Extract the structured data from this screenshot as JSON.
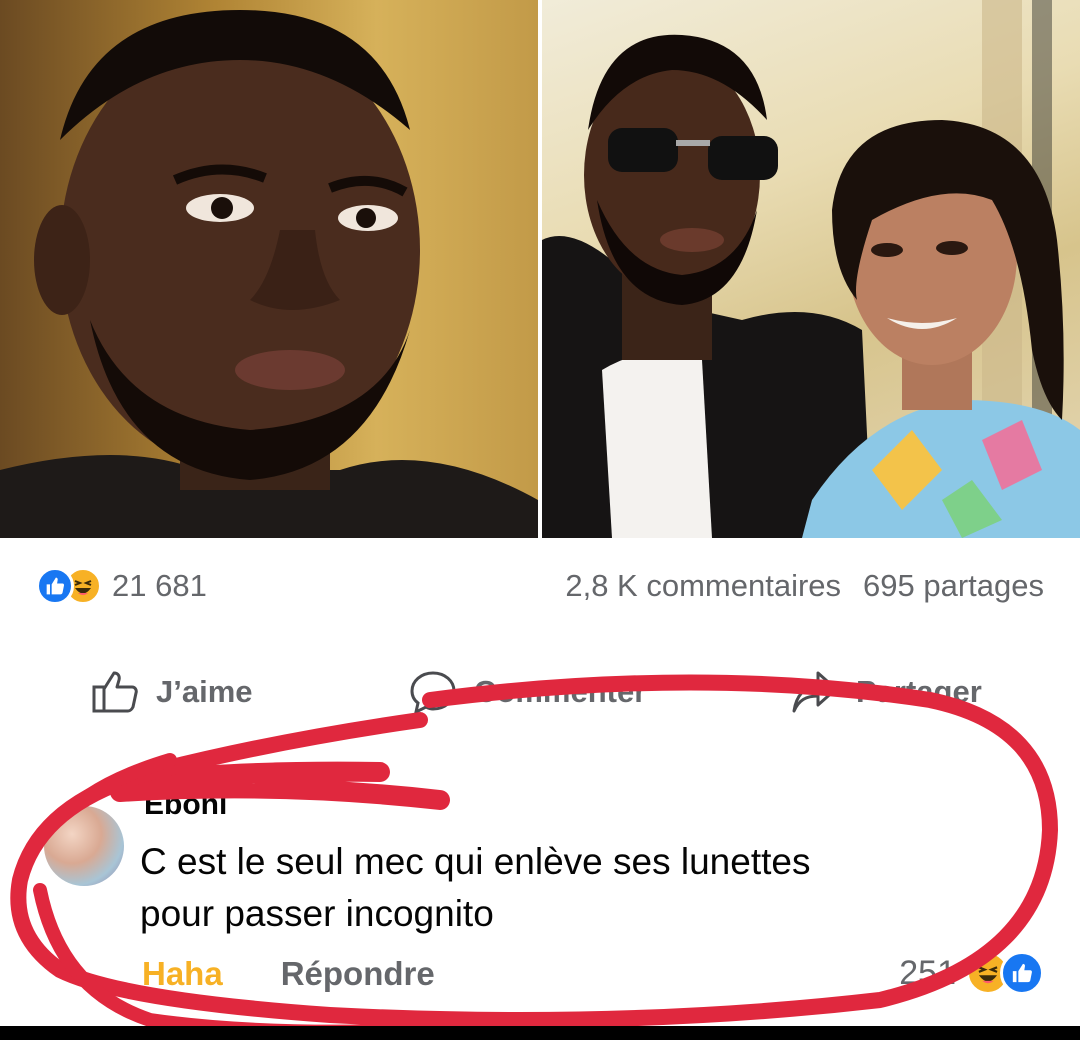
{
  "post": {
    "photos": [
      {
        "name": "photo-left",
        "description_icon": "portrait"
      },
      {
        "name": "photo-right",
        "description_icon": "couple-portrait"
      }
    ]
  },
  "stats": {
    "reaction_icons": [
      "like-icon",
      "haha-icon"
    ],
    "reaction_count": "21 681",
    "comments": "2,8 K commentaires",
    "shares": "695 partages"
  },
  "actions": {
    "like_label": "J’aime",
    "comment_label": "Commenter",
    "share_label": "Partager"
  },
  "comment": {
    "author": "Eboni",
    "text_line1": "C est le seul mec qui enlève ses lunettes",
    "text_line2": "pour passer incognito",
    "haha_label": "Haha",
    "reply_label": "Répondre",
    "reaction_count": "251",
    "reaction_icons": [
      "haha-icon",
      "like-icon"
    ]
  },
  "colors": {
    "facebook_blue": "#1877f2",
    "haha_yellow": "#f7b125",
    "secondary_text": "#65676b",
    "annotation_red": "#e0283e"
  }
}
